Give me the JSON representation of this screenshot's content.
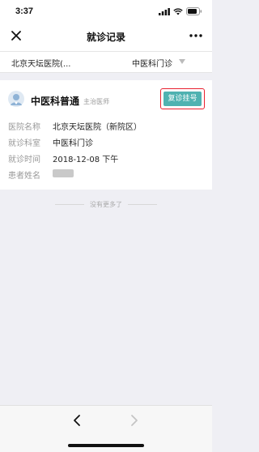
{
  "status_bar": {
    "time": "3:37"
  },
  "nav": {
    "title": "就诊记录"
  },
  "filter": {
    "hospital": "北京天坛医院(...",
    "department": "中医科门诊"
  },
  "record": {
    "title": "中医科普通",
    "doctor_level": "主治医师",
    "action_label": "复诊挂号",
    "fields": [
      {
        "label": "医院名称",
        "value": "北京天坛医院（新院区）"
      },
      {
        "label": "就诊科室",
        "value": "中医科门诊"
      },
      {
        "label": "就诊时间",
        "value": "2018-12-08 下午"
      },
      {
        "label": "患者姓名",
        "value": ""
      }
    ]
  },
  "end_text": "没有更多了",
  "icons": [
    "signal-icon",
    "wifi-icon",
    "battery-icon",
    "close-icon",
    "more-icon",
    "dropdown-caret-icon",
    "doctor-avatar-icon",
    "back-arrow-icon",
    "forward-arrow-icon"
  ],
  "colors": {
    "accent": "#4fb2b1",
    "highlight_border": "#e8202f",
    "background": "#efeff4"
  }
}
